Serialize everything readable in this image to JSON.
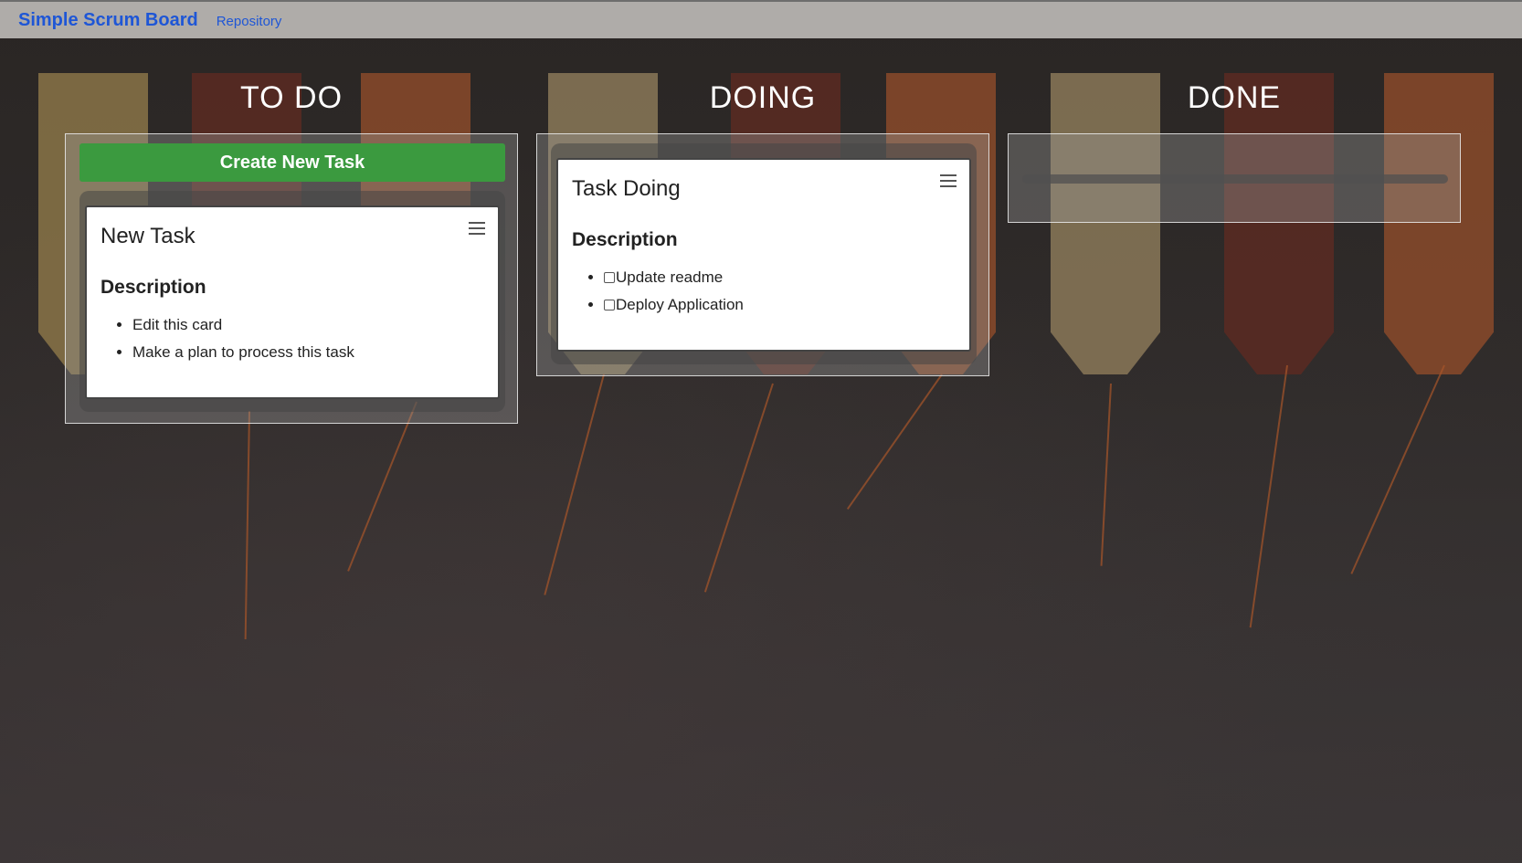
{
  "navbar": {
    "brand": "Simple Scrum Board",
    "repository_link": "Repository"
  },
  "columns": [
    {
      "title": "TO DO",
      "create_button": "Create New Task",
      "cards": [
        {
          "title": "New Task",
          "subtitle": "Description",
          "items": [
            "Edit this card",
            "Make a plan to process this task"
          ]
        }
      ]
    },
    {
      "title": "DOING",
      "cards": [
        {
          "title": "Task Doing",
          "subtitle": "Description",
          "items": [
            "Update readme",
            "Deploy Application"
          ],
          "items_checked": [
            false,
            false
          ]
        }
      ]
    },
    {
      "title": "DONE",
      "cards": []
    }
  ],
  "colors": {
    "brand": "#1e56d6",
    "create_button": "#3b9a3f",
    "navbar": "#b9b7b4"
  },
  "icons": {
    "card_menu": "hamburger-menu-icon",
    "checkbox": "checkbox-icon"
  }
}
